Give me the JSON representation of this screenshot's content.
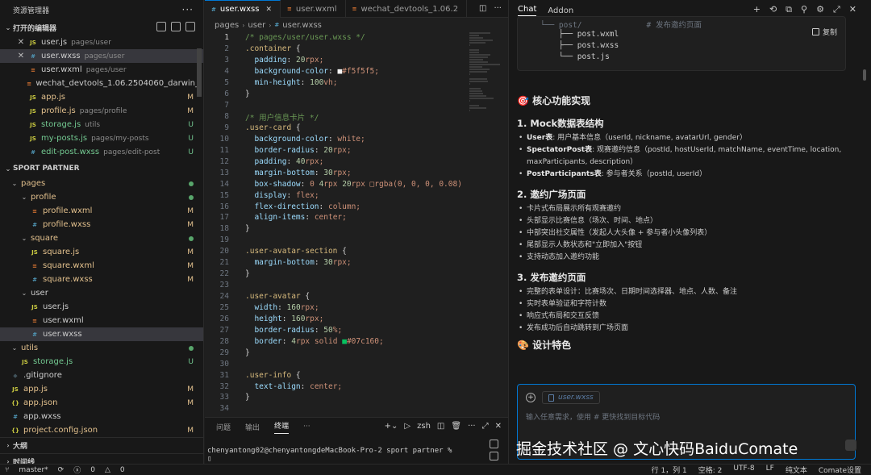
{
  "explorer": {
    "title": "资源管理器",
    "open_editors_label": "打开的编辑器",
    "open_editors": [
      {
        "name": "user.js",
        "path": "pages/user",
        "type": "JS",
        "badge": ""
      },
      {
        "name": "user.wxss",
        "path": "pages/user",
        "type": "wxss",
        "badge": ""
      },
      {
        "name": "user.wxml",
        "path": "pages/user",
        "type": "wxml",
        "badge": ""
      },
      {
        "name": "wechat_devtools_1.06.2504060_darwin_",
        "path": "",
        "type": "wxml",
        "badge": ""
      },
      {
        "name": "app.js",
        "path": "",
        "type": "JS",
        "badge": "M"
      },
      {
        "name": "profile.js",
        "path": "pages/profile",
        "type": "JS",
        "badge": "M"
      },
      {
        "name": "storage.js",
        "path": "utils",
        "type": "JS",
        "badge": "U"
      },
      {
        "name": "my-posts.js",
        "path": "pages/my-posts",
        "type": "JS",
        "badge": "U"
      },
      {
        "name": "edit-post.wxss",
        "path": "pages/edit-post",
        "type": "wxss",
        "badge": "U"
      }
    ],
    "project_label": "SPORT PARTNER",
    "tree": [
      {
        "name": "pages",
        "kind": "folder",
        "depth": 0,
        "badge": "dot"
      },
      {
        "name": "profile",
        "kind": "folder",
        "depth": 1,
        "badge": "dot"
      },
      {
        "name": "profile.wxml",
        "kind": "wxml",
        "depth": 2,
        "badge": "M"
      },
      {
        "name": "profile.wxss",
        "kind": "wxss",
        "depth": 2,
        "badge": "M"
      },
      {
        "name": "square",
        "kind": "folder",
        "depth": 1,
        "badge": "dot"
      },
      {
        "name": "square.js",
        "kind": "JS",
        "depth": 2,
        "badge": "M"
      },
      {
        "name": "square.wxml",
        "kind": "wxml",
        "depth": 2,
        "badge": "M"
      },
      {
        "name": "square.wxss",
        "kind": "wxss",
        "depth": 2,
        "badge": "M"
      },
      {
        "name": "user",
        "kind": "folder",
        "depth": 1,
        "badge": ""
      },
      {
        "name": "user.js",
        "kind": "JS",
        "depth": 2,
        "badge": ""
      },
      {
        "name": "user.wxml",
        "kind": "wxml",
        "depth": 2,
        "badge": ""
      },
      {
        "name": "user.wxss",
        "kind": "wxss",
        "depth": 2,
        "badge": ""
      },
      {
        "name": "utils",
        "kind": "folder",
        "depth": 0,
        "badge": "dot"
      },
      {
        "name": "storage.js",
        "kind": "JS",
        "depth": 1,
        "badge": "U"
      },
      {
        "name": ".gitignore",
        "kind": "git",
        "depth": 0,
        "badge": ""
      },
      {
        "name": "app.js",
        "kind": "JS",
        "depth": 0,
        "badge": "M"
      },
      {
        "name": "app.json",
        "kind": "json",
        "depth": 0,
        "badge": "M"
      },
      {
        "name": "app.wxss",
        "kind": "wxss",
        "depth": 0,
        "badge": ""
      },
      {
        "name": "project.config.json",
        "kind": "json",
        "depth": 0,
        "badge": "M"
      }
    ],
    "outline_label": "大纲",
    "timeline_label": "时间线"
  },
  "editor": {
    "tabs": [
      {
        "name": "user.wxss",
        "type": "wxss",
        "active": true
      },
      {
        "name": "user.wxml",
        "type": "wxml",
        "active": false
      },
      {
        "name": "wechat_devtools_1.06.2",
        "type": "wxml",
        "active": false
      }
    ],
    "breadcrumb": [
      "pages",
      "user",
      "user.wxss"
    ],
    "lines": [
      "/* pages/user/user.wxss */",
      ".container {",
      "  padding: 20rpx;",
      "  background-color: ■#f5f5f5;",
      "  min-height: 100vh;",
      "}",
      "",
      "/* 用户信息卡片 */",
      ".user-card {",
      "  background-color: white;",
      "  border-radius: 20rpx;",
      "  padding: 40rpx;",
      "  margin-bottom: 30rpx;",
      "  box-shadow: 0 4rpx 20rpx □rgba(0, 0, 0, 0.08)",
      "  display: flex;",
      "  flex-direction: column;",
      "  align-items: center;",
      "}",
      "",
      ".user-avatar-section {",
      "  margin-bottom: 30rpx;",
      "}",
      "",
      ".user-avatar {",
      "  width: 160rpx;",
      "  height: 160rpx;",
      "  border-radius: 50%;",
      "  border: 4rpx solid ■#07c160;",
      "}",
      "",
      ".user-info {",
      "  text-align: center;",
      "}",
      ""
    ]
  },
  "terminal": {
    "tabs": [
      "问题",
      "输出",
      "终端"
    ],
    "active_tab": "终端",
    "shell": "zsh",
    "prompt": "chenyantong02@chenyantongdeMacBook-Pro-2 sport partner %",
    "cursor": "▯"
  },
  "chat": {
    "tabs": [
      "Chat",
      "Addon"
    ],
    "code_lines": [
      "└── post/              # 发布邀约页面",
      "    ├── post.wxml",
      "    ├── post.wxss",
      "    └── post.js"
    ],
    "copy_label": "复制",
    "heading": "🎯 核心功能实现",
    "sections": [
      {
        "title": "1. Mock数据表结构",
        "items": [
          {
            "bold": "User表",
            "text": ": 用户基本信息（userId, nickname, avatarUrl, gender）"
          },
          {
            "bold": "SpectatorPost表",
            "text": ": 观赛邀约信息（postId, hostUserId, matchName, eventTime, location, maxParticipants, description）"
          },
          {
            "bold": "PostParticipants表",
            "text": ": 参与者关系（postId, userId）"
          }
        ]
      },
      {
        "title": "2. 邀约广场页面",
        "items": [
          {
            "bold": "",
            "text": "卡片式布局展示所有观赛邀约"
          },
          {
            "bold": "",
            "text": "头部显示比赛信息（场次、时间、地点）"
          },
          {
            "bold": "",
            "text": "中部突出社交属性（发起人大头像 + 参与者小头像列表）"
          },
          {
            "bold": "",
            "text": "尾部显示人数状态和\"立即加入\"按钮"
          },
          {
            "bold": "",
            "text": "支持动态加入邀约功能"
          }
        ]
      },
      {
        "title": "3. 发布邀约页面",
        "items": [
          {
            "bold": "",
            "text": "完整的表单设计：比赛场次、日期时间选择器、地点、人数、备注"
          },
          {
            "bold": "",
            "text": "实时表单验证和字符计数"
          },
          {
            "bold": "",
            "text": "响应式布局和交互反馈"
          },
          {
            "bold": "",
            "text": "发布成功后自动跳转到广场页面"
          }
        ]
      }
    ],
    "design_heading": "🎨 设计特色",
    "input": {
      "attached_file": "user.wxss",
      "placeholder": "输入任意需求，使用 # 更快找到目标代码"
    },
    "watermark": "掘金技术社区 @ 文心快码BaiduComate"
  },
  "statusbar": {
    "branch": "master*",
    "errors": "0",
    "warnings": "0",
    "position": "行 1，列 1",
    "spaces": "空格: 2",
    "encoding": "UTF-8",
    "eol": "LF",
    "language": "纯文本",
    "comate": "Comate设置"
  }
}
